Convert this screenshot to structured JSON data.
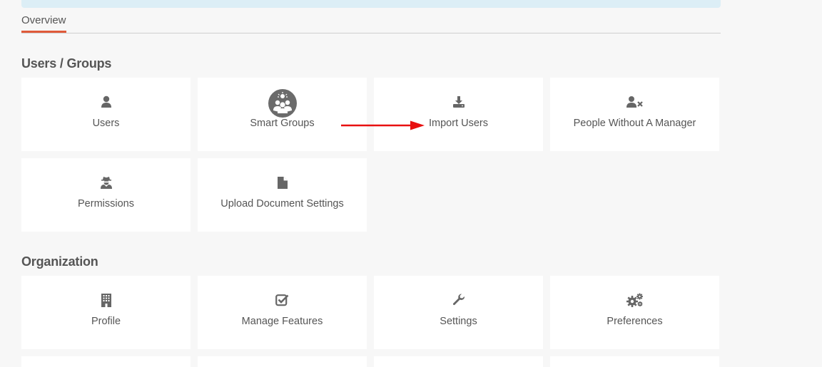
{
  "tabs": [
    {
      "label": "Overview",
      "active": true
    }
  ],
  "sections": {
    "users_groups": {
      "title": "Users / Groups",
      "tiles": [
        {
          "label": "Users",
          "icon": "user-icon"
        },
        {
          "label": "Smart Groups",
          "icon": "smart-groups-icon"
        },
        {
          "label": "Import Users",
          "icon": "download-icon"
        },
        {
          "label": "People Without A Manager",
          "icon": "user-x-icon"
        },
        {
          "label": "Permissions",
          "icon": "user-secret-icon"
        },
        {
          "label": "Upload Document Settings",
          "icon": "file-icon"
        }
      ]
    },
    "organization": {
      "title": "Organization",
      "tiles": [
        {
          "label": "Profile",
          "icon": "building-icon"
        },
        {
          "label": "Manage Features",
          "icon": "check-square-icon"
        },
        {
          "label": "Settings",
          "icon": "wrench-icon"
        },
        {
          "label": "Preferences",
          "icon": "gears-icon"
        }
      ]
    }
  },
  "colors": {
    "accent": "#e05a3a",
    "annotation_arrow": "#e81010",
    "icon": "#666666"
  }
}
